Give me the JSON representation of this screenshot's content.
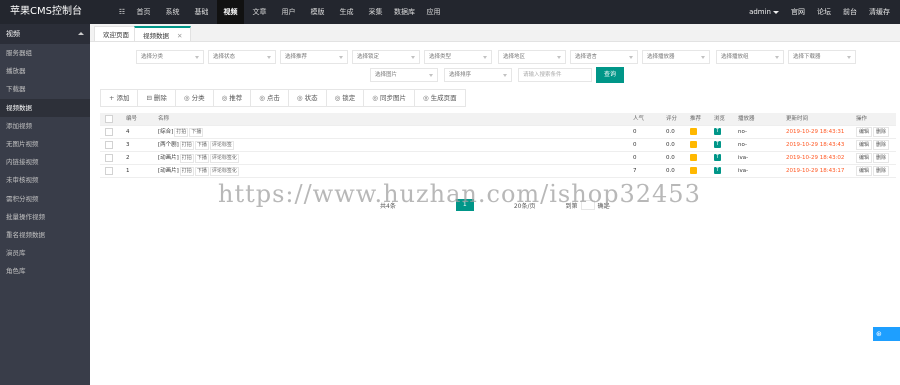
{
  "app": {
    "title": "苹果CMS控制台"
  },
  "topnav": [
    "首页",
    "系统",
    "基础",
    "视频",
    "文章",
    "用户",
    "模版",
    "生成",
    "采集",
    "数据库",
    "应用"
  ],
  "topnav_active": 3,
  "topright": {
    "user": "admin",
    "links": [
      "官网",
      "论坛",
      "前台",
      "清缓存"
    ]
  },
  "sidebar": {
    "header": "视频",
    "items": [
      "服务器组",
      "播放器",
      "下载器",
      "视频数据",
      "添加视频",
      "无图片视频",
      "内链接视频",
      "未审核视频",
      "需积分视频",
      "批量操作视频",
      "重名视频数据",
      "演员库",
      "角色库"
    ],
    "active": 3
  },
  "tabs": [
    "欢迎页面",
    "视频数据"
  ],
  "filters": {
    "row1": [
      "选择分类",
      "选择状态",
      "选择推荐",
      "选择锁定",
      "选择类型",
      "选择地区",
      "选择语言",
      "选择播放器",
      "选择播放组",
      "选择下载器"
    ],
    "row2": [
      "选择图片",
      "选择排序"
    ],
    "search_placeholder": "请输入搜索条件",
    "search_button": "查询"
  },
  "actions": [
    {
      "icon": "+",
      "label": "添加"
    },
    {
      "icon": "⊟",
      "label": "删除"
    },
    {
      "icon": "◎",
      "label": "分类"
    },
    {
      "icon": "◎",
      "label": "推荐"
    },
    {
      "icon": "◎",
      "label": "点击"
    },
    {
      "icon": "◎",
      "label": "状态"
    },
    {
      "icon": "◎",
      "label": "锁定"
    },
    {
      "icon": "◎",
      "label": "同步图片"
    },
    {
      "icon": "◎",
      "label": "生成页面"
    }
  ],
  "table": {
    "headers": [
      "编号",
      "名称",
      "人气",
      "评分",
      "推荐",
      "浏览",
      "播放器",
      "更新时间",
      "操作"
    ],
    "rows": [
      {
        "id": "4",
        "name": "[综合]",
        "tags": [
          "打拍",
          "下播"
        ],
        "hits": "0",
        "score": "0.0",
        "player": "no-",
        "time": "2019-10-29 18:43:31",
        "ops": [
          "编辑",
          "删除"
        ]
      },
      {
        "id": "3",
        "name": "[两个剧]",
        "tags": [
          "打拍",
          "下播",
          "评论标签"
        ],
        "hits": "0",
        "score": "0.0",
        "player": "no-",
        "time": "2019-10-29 18:43:43",
        "ops": [
          "编辑",
          "删除"
        ]
      },
      {
        "id": "2",
        "name": "[动画片]",
        "tags": [
          "打拍",
          "下播",
          "评论标签化"
        ],
        "hits": "0",
        "score": "0.0",
        "player": "iva-",
        "time": "2019-10-29 18:43:02",
        "ops": [
          "编辑",
          "删除"
        ]
      },
      {
        "id": "1",
        "name": "[动画片]",
        "tags": [
          "打拍",
          "下播",
          "评论标签化"
        ],
        "hits": "7",
        "score": "0.0",
        "player": "iva-",
        "time": "2019-10-29 18:43:17",
        "ops": [
          "编辑",
          "删除"
        ]
      }
    ],
    "badge_t": "T"
  },
  "pager": {
    "total": "共4条",
    "current": "1",
    "per_page": "20条/页",
    "goto": "到第",
    "confirm": "确定"
  },
  "watermark": "https://www.huzhan.com/ishop32453"
}
